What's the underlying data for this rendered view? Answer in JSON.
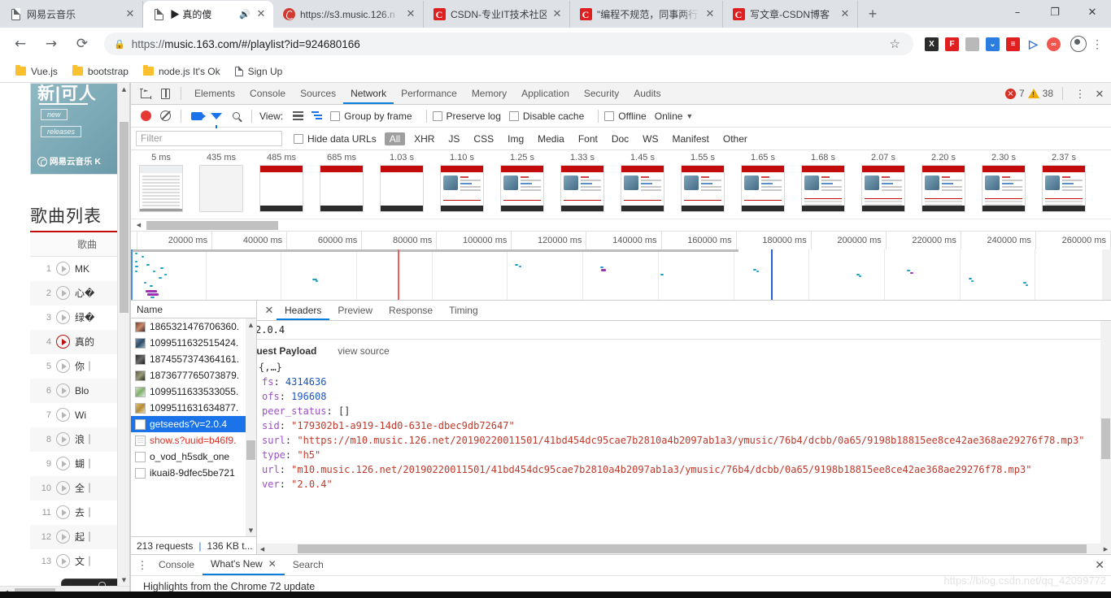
{
  "browser": {
    "tabs": [
      {
        "title": "网易云音乐",
        "favicon": "doc-icon",
        "active": false,
        "audio": false
      },
      {
        "title": "▶ 真的傻",
        "favicon": "doc-icon",
        "active": true,
        "audio": true
      },
      {
        "title": "https://s3.music.126.n",
        "favicon": "netease-icon",
        "active": false,
        "audio": false
      },
      {
        "title": "CSDN-专业IT技术社区",
        "favicon": "csdn-icon",
        "active": false,
        "audio": false
      },
      {
        "title": "\"编程不规范，同事两行",
        "favicon": "csdn-icon",
        "active": false,
        "audio": false
      },
      {
        "title": "写文章-CSDN博客",
        "favicon": "csdn-icon",
        "active": false,
        "audio": false
      }
    ],
    "new_tab_label": "+",
    "window_controls": {
      "minimize": "–",
      "maximize": "❐",
      "close": "✕"
    },
    "nav": {
      "back": "←",
      "forward": "→",
      "reload": "⟳"
    },
    "omnibox": {
      "lock": "🔒",
      "url_prefix": "https://",
      "url_host": "music.163.com",
      "url_path": "/#/playlist?id=924680166",
      "star": "☆"
    },
    "extensions": [
      "x-extension-icon",
      "pdf-extension-icon",
      "grey-extension-icon",
      "blue-chevron-extension-icon",
      "red-list-extension-icon",
      "cursor-extension-icon",
      "infinity-extension-icon"
    ],
    "bookmarks": [
      {
        "label": "Vue.js",
        "icon": "folder-icon"
      },
      {
        "label": "bootstrap",
        "icon": "folder-icon"
      },
      {
        "label": "node.js It's Ok",
        "icon": "folder-icon"
      },
      {
        "label": "Sign Up",
        "icon": "doc-icon"
      }
    ]
  },
  "page": {
    "promo": {
      "heading": "新|可人",
      "pill_new": "new",
      "pill_releases": "releases",
      "logo": "网易云音乐 K"
    },
    "playlist_title": "歌曲列表",
    "table_header": "歌曲",
    "songs": [
      {
        "index": "1",
        "name": "MK",
        "playing": false
      },
      {
        "index": "2",
        "name": "心�",
        "playing": false
      },
      {
        "index": "3",
        "name": "绿�",
        "playing": false
      },
      {
        "index": "4",
        "name": "真的",
        "playing": true
      },
      {
        "index": "5",
        "name": "你｜",
        "playing": false
      },
      {
        "index": "6",
        "name": "Blo",
        "playing": false
      },
      {
        "index": "7",
        "name": "Wi",
        "playing": false
      },
      {
        "index": "8",
        "name": "浪｜",
        "playing": false
      },
      {
        "index": "9",
        "name": "蝴｜",
        "playing": false
      },
      {
        "index": "10",
        "name": "全｜",
        "playing": false
      },
      {
        "index": "11",
        "name": "去｜",
        "playing": false
      },
      {
        "index": "12",
        "name": "起｜",
        "playing": false
      },
      {
        "index": "13",
        "name": "文｜",
        "playing": false
      }
    ]
  },
  "devtools": {
    "main_tabs": [
      {
        "label": "Elements",
        "active": false
      },
      {
        "label": "Console",
        "active": false
      },
      {
        "label": "Sources",
        "active": false
      },
      {
        "label": "Network",
        "active": true
      },
      {
        "label": "Performance",
        "active": false
      },
      {
        "label": "Memory",
        "active": false
      },
      {
        "label": "Application",
        "active": false
      },
      {
        "label": "Security",
        "active": false
      },
      {
        "label": "Audits",
        "active": false
      }
    ],
    "status": {
      "errors": "7",
      "warnings": "38"
    },
    "network_toolbar": {
      "view_label": "View:",
      "group_by_frame": "Group by frame",
      "preserve_log": "Preserve log",
      "disable_cache": "Disable cache",
      "offline": "Offline",
      "throttling": "Online"
    },
    "filter_row": {
      "filter_placeholder": "Filter",
      "hide_data_urls": "Hide data URLs",
      "types": [
        "All",
        "XHR",
        "JS",
        "CSS",
        "Img",
        "Media",
        "Font",
        "Doc",
        "WS",
        "Manifest",
        "Other"
      ],
      "active_type": "All"
    },
    "filmstrip": [
      {
        "time": "5 ms",
        "state": "full"
      },
      {
        "time": "435 ms",
        "state": "blank"
      },
      {
        "time": "485 ms",
        "state": "header"
      },
      {
        "time": "685 ms",
        "state": "header"
      },
      {
        "time": "1.03 s",
        "state": "header"
      },
      {
        "time": "1.10 s",
        "state": "album"
      },
      {
        "time": "1.25 s",
        "state": "album"
      },
      {
        "time": "1.33 s",
        "state": "album"
      },
      {
        "time": "1.45 s",
        "state": "album"
      },
      {
        "time": "1.55 s",
        "state": "album"
      },
      {
        "time": "1.65 s",
        "state": "album"
      },
      {
        "time": "1.68 s",
        "state": "albumlist"
      },
      {
        "time": "2.07 s",
        "state": "albumlist"
      },
      {
        "time": "2.20 s",
        "state": "albumlist"
      },
      {
        "time": "2.30 s",
        "state": "albumlist"
      },
      {
        "time": "2.37 s",
        "state": "albumlist"
      }
    ],
    "timeline": {
      "ticks": [
        "20000 ms",
        "40000 ms",
        "60000 ms",
        "80000 ms",
        "100000 ms",
        "120000 ms",
        "140000 ms",
        "160000 ms",
        "180000 ms",
        "200000 ms",
        "220000 ms",
        "240000 ms",
        "260000 ms"
      ],
      "dom_content_loaded_color": "#1a73e8",
      "load_event_color": "#e86060"
    },
    "requests": {
      "column_header": "Name",
      "rows": [
        {
          "name": "1865321476706360.",
          "icon": "image-icon",
          "state": "normal"
        },
        {
          "name": "1099511632515424.",
          "icon": "image-icon",
          "state": "normal"
        },
        {
          "name": "1874557374364161.",
          "icon": "image-icon",
          "state": "normal"
        },
        {
          "name": "1873677765073879.",
          "icon": "image-icon",
          "state": "normal"
        },
        {
          "name": "1099511633533055.",
          "icon": "image-icon",
          "state": "normal"
        },
        {
          "name": "1099511631634877.",
          "icon": "image-icon",
          "state": "normal"
        },
        {
          "name": "getseeds?v=2.0.4",
          "icon": "doc-icon",
          "state": "selected"
        },
        {
          "name": "show.s?uuid=b46f9.",
          "icon": "doc-icon",
          "state": "error"
        },
        {
          "name": "o_vod_h5sdk_one",
          "icon": "doc-icon",
          "state": "normal"
        },
        {
          "name": "ikuai8-9dfec5be721",
          "icon": "doc-icon",
          "state": "normal"
        }
      ],
      "footer": {
        "requests": "213 requests",
        "sep": "|",
        "transferred": "136 KB t..."
      }
    },
    "details": {
      "tabs": [
        {
          "label": "Headers",
          "active": true
        },
        {
          "label": "Preview",
          "active": false
        },
        {
          "label": "Response",
          "active": false
        },
        {
          "label": "Timing",
          "active": false
        }
      ],
      "close": "✕",
      "last_header_line": "2.0.4",
      "payload_title": "quest Payload",
      "view_source": "view source",
      "json_root": "{,…}",
      "json_lines": [
        {
          "key": "fs",
          "value": "4314636",
          "vtype": "num"
        },
        {
          "key": "ofs",
          "value": "196608",
          "vtype": "num"
        },
        {
          "key": "peer_status",
          "value": "[]",
          "vtype": "punct"
        },
        {
          "key": "sid",
          "value": "\"179302b1-a919-14d0-631e-dbec9db72647\"",
          "vtype": "str"
        },
        {
          "key": "surl",
          "value": "\"https://m10.music.126.net/20190220011501/41bd454dc95cae7b2810a4b2097ab1a3/ymusic/76b4/dcbb/0a65/9198b18815ee8ce42ae368ae29276f78.mp3\"",
          "vtype": "str"
        },
        {
          "key": "type",
          "value": "\"h5\"",
          "vtype": "str"
        },
        {
          "key": "url",
          "value": "\"m10.music.126.net/20190220011501/41bd454dc95cae7b2810a4b2097ab1a3/ymusic/76b4/dcbb/0a65/9198b18815ee8ce42ae368ae29276f78.mp3\"",
          "vtype": "str"
        },
        {
          "key": "ver",
          "value": "\"2.0.4\"",
          "vtype": "str"
        }
      ]
    },
    "drawer": {
      "tabs": [
        {
          "label": "Console",
          "active": false,
          "closable": false
        },
        {
          "label": "What's New",
          "active": true,
          "closable": true
        },
        {
          "label": "Search",
          "active": false,
          "closable": false
        }
      ],
      "content": "Highlights from the Chrome 72 update",
      "close": "✕"
    }
  },
  "watermark": "https://blog.csdn.net/qq_42099772"
}
